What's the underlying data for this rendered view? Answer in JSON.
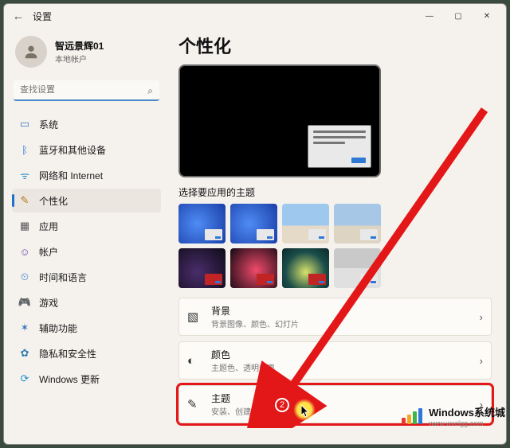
{
  "window": {
    "title": "设置",
    "controls": {
      "minimize": "—",
      "maximize": "▢",
      "close": "✕"
    },
    "back_icon": "←"
  },
  "profile": {
    "name": "智远景辉01",
    "subtitle": "本地帐户"
  },
  "search": {
    "placeholder": "查找设置"
  },
  "nav": {
    "items": [
      {
        "label": "系统",
        "icon": "▭"
      },
      {
        "label": "蓝牙和其他设备",
        "icon": "ᛒ"
      },
      {
        "label": "网络和 Internet",
        "icon": "ᯤ"
      },
      {
        "label": "个性化",
        "icon": "✎",
        "active": true
      },
      {
        "label": "应用",
        "icon": "▦"
      },
      {
        "label": "帐户",
        "icon": "☺"
      },
      {
        "label": "时间和语言",
        "icon": "⏲"
      },
      {
        "label": "游戏",
        "icon": "🎮"
      },
      {
        "label": "辅助功能",
        "icon": "✶"
      },
      {
        "label": "隐私和安全性",
        "icon": "✿"
      },
      {
        "label": "Windows 更新",
        "icon": "⟳"
      }
    ]
  },
  "page": {
    "title": "个性化",
    "theme_section_label": "选择要应用的主题",
    "rows": [
      {
        "key": "background",
        "icon": "▧",
        "title": "背景",
        "subtitle": "背景图像、颜色、幻灯片"
      },
      {
        "key": "colors",
        "icon": "◐",
        "title": "颜色",
        "subtitle": "主题色、透明效果"
      },
      {
        "key": "themes",
        "icon": "✎",
        "title": "主题",
        "subtitle": "安装、创建、管理",
        "highlight": true
      }
    ],
    "chevron": "›"
  },
  "annotation": {
    "step_number": "2"
  },
  "watermark": {
    "line1": "Windows系统城",
    "line2": "www.wxclgg.com"
  }
}
